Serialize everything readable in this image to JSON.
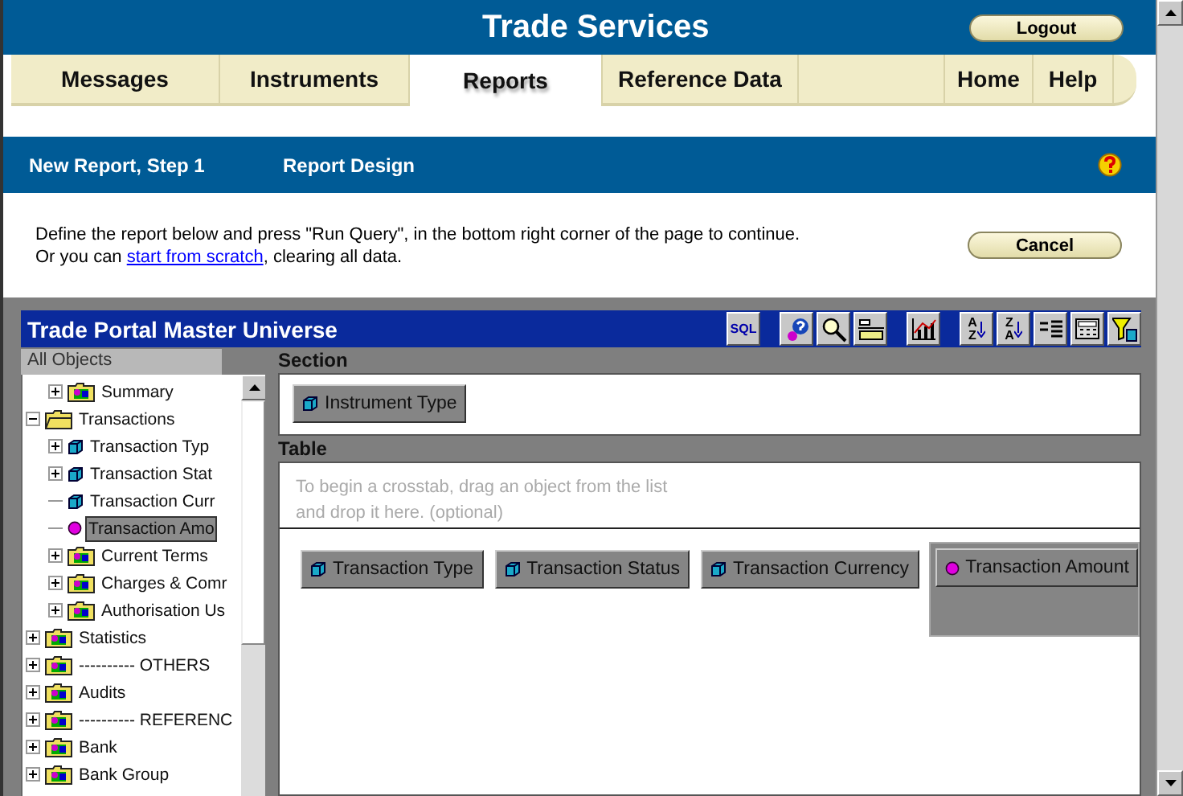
{
  "header": {
    "title": "Trade Services",
    "logout": "Logout"
  },
  "tabs": [
    {
      "label": "Messages",
      "selected": false
    },
    {
      "label": "Instruments",
      "selected": false
    },
    {
      "label": "Reports",
      "selected": true
    },
    {
      "label": "Reference Data",
      "selected": false
    }
  ],
  "links": [
    {
      "label": "Home",
      "selected": false
    },
    {
      "label": "Help",
      "selected": false
    }
  ],
  "step_bar": {
    "step": "New Report, Step 1",
    "page": "Report Design"
  },
  "intro": {
    "line1": "Define the report below and press \"Run Query\", in the bottom right corner of the page to continue.",
    "before_link": "Or you can ",
    "link": "start from scratch",
    "after_link": ", clearing all data.",
    "cancel": "Cancel"
  },
  "universe": {
    "title": "Trade Portal Master Universe",
    "toolbar": [
      [
        {
          "kind": "sql",
          "text": "SQL"
        }
      ],
      [
        {
          "kind": "help"
        },
        {
          "kind": "find"
        },
        {
          "kind": "layout"
        }
      ],
      [
        {
          "kind": "chart"
        }
      ],
      [
        {
          "kind": "sort",
          "top": "A",
          "bottom": "Z"
        },
        {
          "kind": "sort",
          "top": "Z",
          "bottom": "A"
        },
        {
          "kind": "list"
        },
        {
          "kind": "calculator"
        },
        {
          "kind": "filter"
        }
      ]
    ]
  },
  "objects": {
    "tab": "All Objects",
    "tree": [
      {
        "children": [
          {
            "label": "Summary",
            "kind": "folder",
            "expanded": false,
            "selected": false
          }
        ]
      },
      {
        "label": "Transactions",
        "kind": "folder",
        "expanded": true,
        "selected": false,
        "children": [
          {
            "label": "Transaction Typ",
            "kind": "dimension",
            "expanded": false,
            "selected": false
          },
          {
            "label": "Transaction Stat",
            "kind": "dimension",
            "expanded": false,
            "selected": false
          },
          {
            "label": "Transaction Curr",
            "kind": "dimension",
            "selected": false
          },
          {
            "label": "Transaction Amo",
            "kind": "measure",
            "selected": true
          },
          {
            "label": "Current Terms",
            "kind": "folder",
            "expanded": false,
            "selected": false
          },
          {
            "label": "Charges & Comr",
            "kind": "folder",
            "expanded": false,
            "selected": false
          },
          {
            "label": "Authorisation Us",
            "kind": "folder",
            "expanded": false,
            "selected": false
          }
        ]
      },
      {
        "label": "Statistics",
        "kind": "folder",
        "expanded": false,
        "selected": false
      },
      {
        "label": "---------- OTHERS",
        "kind": "folder",
        "expanded": false,
        "selected": false
      },
      {
        "label": "Audits",
        "kind": "folder",
        "expanded": false,
        "selected": false
      },
      {
        "label": "---------- REFERENC",
        "kind": "folder",
        "expanded": false,
        "selected": false
      },
      {
        "label": "Bank",
        "kind": "folder",
        "expanded": false,
        "selected": false
      },
      {
        "label": "Bank Group",
        "kind": "folder",
        "expanded": false,
        "selected": false
      }
    ]
  },
  "section": {
    "label": "Section",
    "chips": [
      {
        "label": "Instrument Type",
        "kind": "dimension"
      }
    ]
  },
  "table": {
    "label": "Table",
    "hint1": "To begin a crosstab, drag an object from the list",
    "hint2": "and drop it here. (optional)",
    "chips": [
      {
        "label": "Transaction Type",
        "kind": "dimension",
        "selected": false
      },
      {
        "label": "Transaction Status",
        "kind": "dimension",
        "selected": false
      },
      {
        "label": "Transaction Currency",
        "kind": "dimension",
        "selected": false
      },
      {
        "label": "Transaction Amount",
        "kind": "measure",
        "selected": true
      }
    ]
  }
}
